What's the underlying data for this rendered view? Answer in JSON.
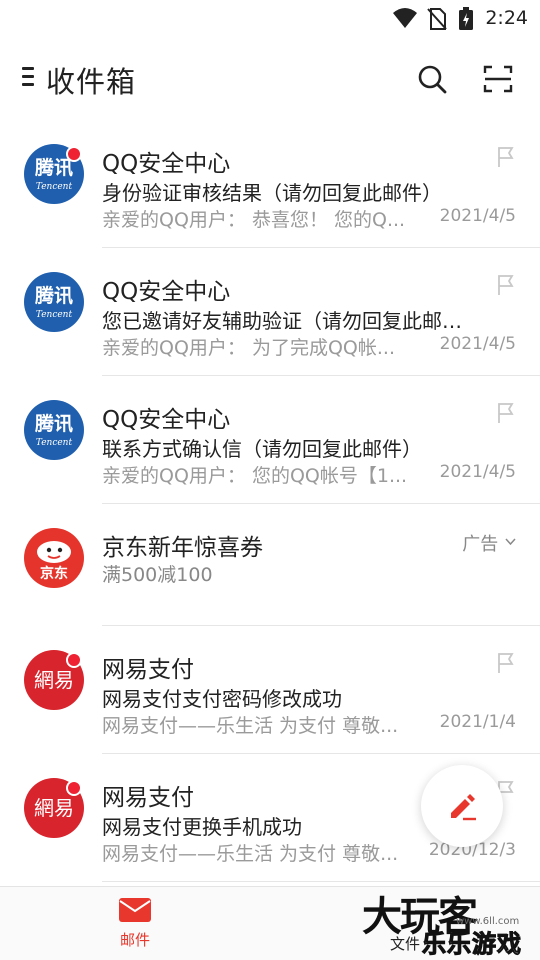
{
  "status_bar": {
    "time": "2:24"
  },
  "header": {
    "title": "收件箱"
  },
  "mails": [
    {
      "sender": "QQ安全中心",
      "subject": "身份验证审核结果（请勿回复此邮件）",
      "preview": "亲爱的QQ用户： 恭喜您！ 您的Q...",
      "date": "2021/4/5",
      "avatar": "tencent",
      "unread": true
    },
    {
      "sender": "QQ安全中心",
      "subject": "您已邀请好友辅助验证（请勿回复此邮…",
      "preview": "亲爱的QQ用户： 为了完成QQ帐...",
      "date": "2021/4/5",
      "avatar": "tencent",
      "unread": false
    },
    {
      "sender": "QQ安全中心",
      "subject": "联系方式确认信（请勿回复此邮件）",
      "preview": "亲爱的QQ用户： 您的QQ帐号【1...",
      "date": "2021/4/5",
      "avatar": "tencent",
      "unread": false
    },
    {
      "sender": "网易支付",
      "subject": "网易支付支付密码修改成功",
      "preview": "网易支付——乐生活 为支付 尊敬...",
      "date": "2021/1/4",
      "avatar": "netease",
      "unread": true
    },
    {
      "sender": "网易支付",
      "subject": "网易支付更换手机成功",
      "preview": "网易支付——乐生活 为支付 尊敬...",
      "date": "2020/12/3",
      "avatar": "netease",
      "unread": true
    }
  ],
  "ad": {
    "title": "京东新年惊喜券",
    "description": "满500减100",
    "label": "广告",
    "logo_text": "京东"
  },
  "avatars": {
    "tencent_main": "腾讯",
    "tencent_sub": "Tencent",
    "netease": "網易"
  },
  "bottom_nav": {
    "mail_label": "邮件",
    "files_label": "文件"
  },
  "watermark": {
    "main": "大玩客",
    "sub": "乐乐游戏",
    "url": "www.6ll.com"
  },
  "colors": {
    "accent": "#e8372c",
    "tencent_blue": "#1f5fae",
    "netease_red": "#d8242c",
    "jd_red": "#e5342b"
  }
}
